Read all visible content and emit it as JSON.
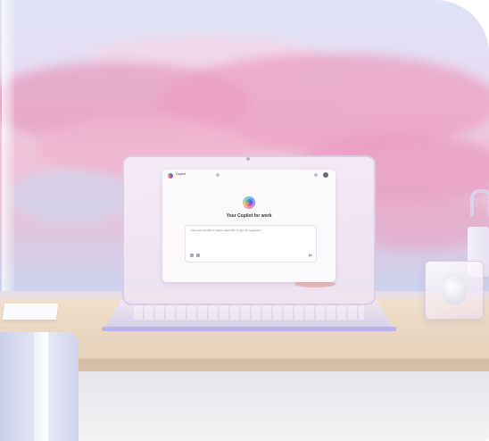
{
  "scene": {
    "colors": {
      "sky_top": "#dfe4f7",
      "clouds_pink": "#ec9fc2",
      "desk": "#e6d1b9",
      "laptop_accent": "#b8b2e6"
    }
  },
  "screen": {
    "app_name": "Copilot",
    "heading": "Your Copilot for work",
    "prompt_placeholder": "Ask a work question or request, attach files, or type / for suggestions"
  }
}
